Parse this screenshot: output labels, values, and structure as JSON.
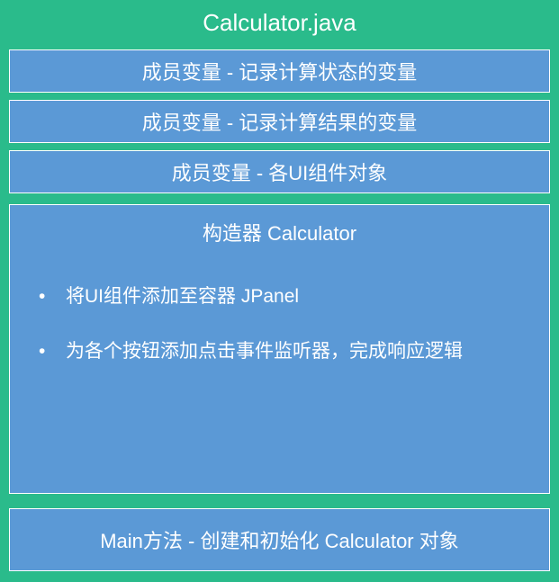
{
  "title": "Calculator.java",
  "rows": [
    "成员变量 - 记录计算状态的变量",
    "成员变量 - 记录计算结果的变量",
    "成员变量 - 各UI组件对象"
  ],
  "constructor": {
    "title": "构造器 Calculator",
    "bullets": [
      "将UI组件添加至容器 JPanel",
      "为各个按钮添加点击事件监听器，完成响应逻辑"
    ]
  },
  "main_method": "Main方法 - 创建和初始化 Calculator 对象",
  "colors": {
    "background": "#2abb8b",
    "box": "#5b99d6",
    "text": "#ffffff"
  }
}
